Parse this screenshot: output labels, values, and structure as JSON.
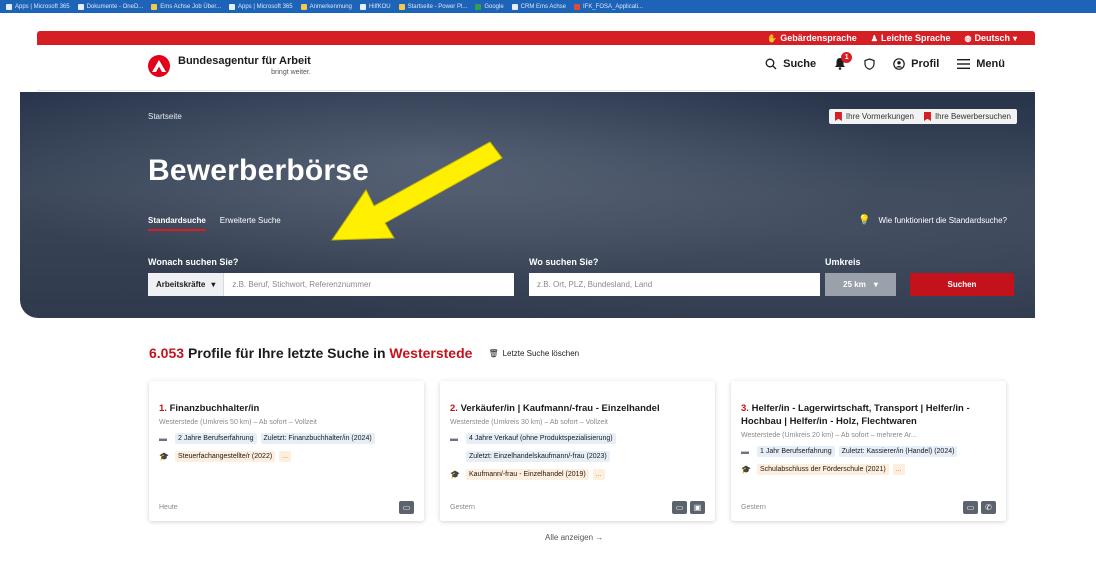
{
  "bookmarks": [
    {
      "label": "Apps | Microsoft 365",
      "icon": "app-icon"
    },
    {
      "label": "Dokumente - OneD...",
      "icon": "cloud-icon"
    },
    {
      "label": "Ems Achse Job Über...",
      "icon": "folder-icon"
    },
    {
      "label": "Apps | Microsoft 365",
      "icon": "app-icon"
    },
    {
      "label": "Anmerkenmung",
      "icon": "folder-icon"
    },
    {
      "label": "HilfKOU",
      "icon": "app-icon"
    },
    {
      "label": "Startseite - Power Pl...",
      "icon": "app-icon"
    },
    {
      "label": "Google",
      "icon": "google-icon"
    },
    {
      "label": "CRM Ems Achse",
      "icon": "app-icon"
    },
    {
      "label": "IFK_FOSA_Applicati...",
      "icon": "app-icon"
    }
  ],
  "topbar": {
    "sign_language": "Gebärdensprache",
    "easy_language": "Leichte Sprache",
    "language": "Deutsch"
  },
  "header": {
    "logo_title": "Bundesagentur für Arbeit",
    "logo_sub": "bringt weiter.",
    "search": "Suche",
    "notifications_count": "1",
    "profile": "Profil",
    "menu": "Menü"
  },
  "hero": {
    "breadcrumb": "Startseite",
    "bookmarks_btn": "Ihre Vormerkungen",
    "saved_searches_btn": "Ihre Bewerbersuchen",
    "title": "Bewerberbörse",
    "tab_standard": "Standardsuche",
    "tab_advanced": "Erweiterte Suche",
    "help": "Wie funktioniert die Standardsuche?",
    "what_label": "Wonach suchen Sie?",
    "category": "Arbeitskräfte",
    "what_placeholder": "z.B. Beruf, Stichwort, Referenznummer",
    "where_label": "Wo suchen Sie?",
    "where_placeholder": "z.B. Ort, PLZ, Bundesland, Land",
    "radius_label": "Umkreis",
    "radius_value": "25 km",
    "search_button": "Suchen"
  },
  "results": {
    "count": "6.053",
    "text": "Profile für Ihre letzte Suche in",
    "location": "Westerstede",
    "clear": "Letzte Suche löschen",
    "show_all": "Alle anzeigen →"
  },
  "cards": [
    {
      "num": "1.",
      "title": "Finanzbuchhalter/in",
      "meta": "Westerstede (Umkreis 50 km) – Ab sofort – Vollzeit",
      "exp1": "2 Jahre Berufserfahrung",
      "exp2": "Zuletzt: Finanzbuchhalter/in (2024)",
      "edu": "Steuerfachangestellte/r (2022)",
      "more": "...",
      "date": "Heute"
    },
    {
      "num": "2.",
      "title": "Verkäufer/in  |  Kaufmann/-frau - Einzelhandel",
      "meta": "Westerstede (Umkreis 30 km) – Ab sofort – Vollzeit",
      "exp1": "4 Jahre Verkauf (ohne Produktspezialisierung)",
      "exp2": "Zuletzt: Einzelhandelskaufmann/-frau (2023)",
      "edu": "Kaufmann/-frau - Einzelhandel (2019)",
      "more": "...",
      "date": "Gestern"
    },
    {
      "num": "3.",
      "title": "Helfer/in - Lagerwirtschaft, Transport  |  Helfer/in - Hochbau  |  Helfer/in - Holz, Flechtwaren",
      "meta": "Westerstede (Umkreis 20 km) – Ab sofort – mehrere Ar...",
      "exp1": "1 Jahr Berufserfahrung",
      "exp2": "Zuletzt: Kassierer/in (Handel) (2024)",
      "edu": "Schulabschluss der Förderschule (2021)",
      "more": "...",
      "date": "Gestern"
    }
  ]
}
